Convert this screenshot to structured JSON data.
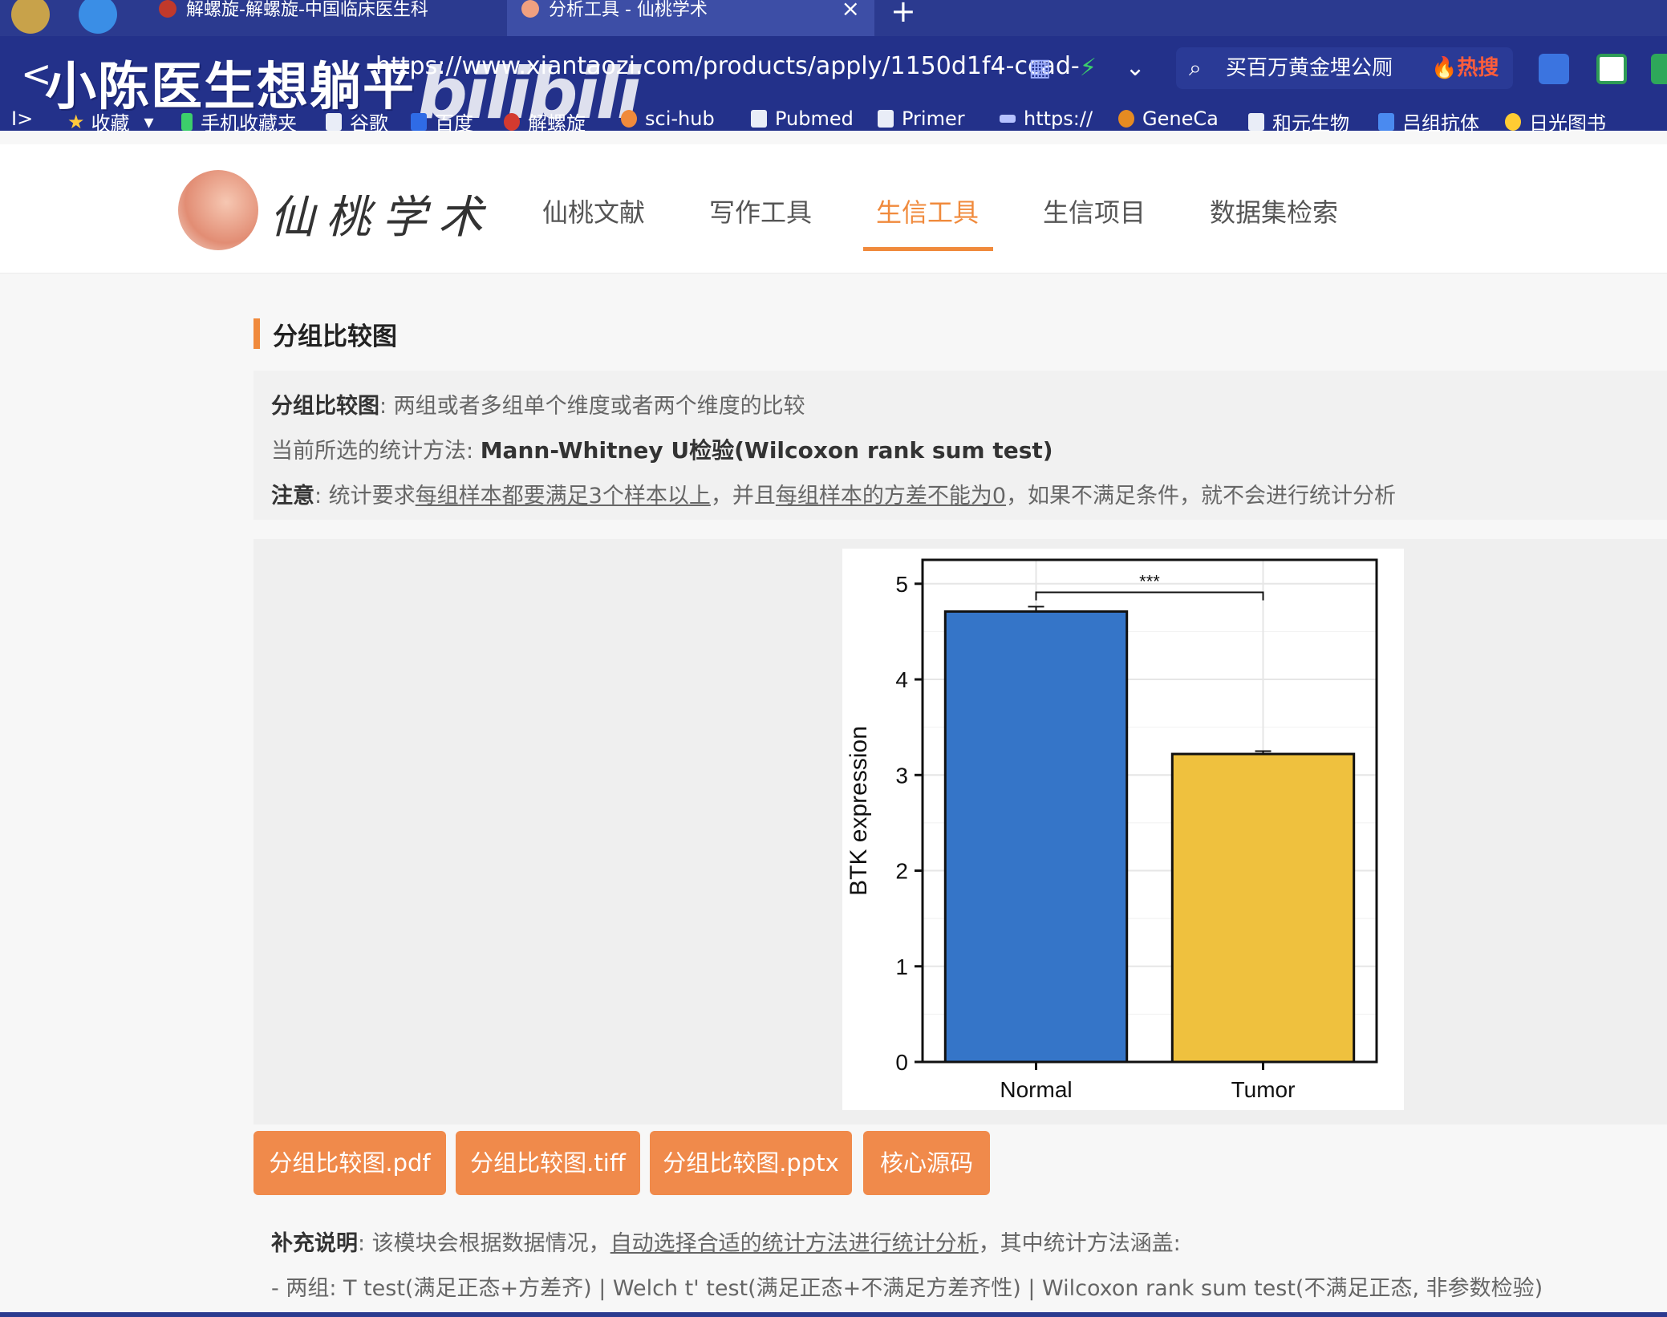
{
  "browser": {
    "tabs": [
      {
        "label": "解螺旋-解螺旋-中国临床医生科"
      },
      {
        "label": "分析工具 - 仙桃学术",
        "close": "×"
      }
    ],
    "new_tab": "+",
    "back": "<",
    "watermark": "小陈医生想躺平",
    "watermark_brand": "bilibili",
    "url": "https://www.xiantaozi.com/products/apply/1150d1f4-ccad-",
    "search_text": "买百万黄金埋公厕",
    "search_hot": "🔥热搜",
    "bookmarks": [
      {
        "label": "收藏"
      },
      {
        "label": "手机收藏夹"
      },
      {
        "label": "谷歌"
      },
      {
        "label": "百度"
      },
      {
        "label": "解螺旋"
      },
      {
        "label": "sci-hub"
      },
      {
        "label": "Pubmed"
      },
      {
        "label": "Primer"
      },
      {
        "label": "https://"
      },
      {
        "label": "GeneCa"
      },
      {
        "label": "和元生物"
      },
      {
        "label": "吕组抗体"
      },
      {
        "label": "日光图书"
      }
    ]
  },
  "site": {
    "logo_text": "仙桃学术",
    "nav": [
      "仙桃文献",
      "写作工具",
      "生信工具",
      "生信项目",
      "数据集检索"
    ],
    "active_nav": "生信工具"
  },
  "page": {
    "section_title": "分组比较图",
    "desc_label": "分组比较图",
    "desc_text": ": 两组或者多组单个维度或者两个维度的比较",
    "method_label": "当前所选的统计方法: ",
    "method_value": "Mann-Whitney U检验(Wilcoxon rank sum test)",
    "note_label": "注意",
    "note_pre": ": 统计要求",
    "note_u1": "每组样本都要满足3个样本以上",
    "note_mid": "，并且",
    "note_u2": "每组样本的方差不能为0",
    "note_post": "，如果不满足条件，就不会进行统计分析",
    "buttons": [
      "分组比较图.pdf",
      "分组比较图.tiff",
      "分组比较图.pptx",
      "核心源码"
    ],
    "supp_label": "补充说明",
    "supp_pre": ": 该模块会根据数据情况，",
    "supp_u": "自动选择合适的统计方法进行统计分析",
    "supp_post": "，其中统计方法涵盖:",
    "supp_line2": "- 两组: T test(满足正态+方差齐) | Welch t' test(满足正态+不满足方差齐性) | Wilcoxon rank sum test(不满足正态, 非参数检验)"
  },
  "chart_data": {
    "type": "bar",
    "categories": [
      "Normal",
      "Tumor"
    ],
    "values": [
      4.71,
      3.22
    ],
    "errors": [
      0.05,
      0.03
    ],
    "colors": [
      "#3575c8",
      "#efc13e"
    ],
    "ylabel": "BTK expression",
    "xlabel": "",
    "ylim": [
      0,
      5.25
    ],
    "yticks": [
      0,
      1,
      2,
      3,
      4,
      5
    ],
    "significance": "***",
    "grid": true
  }
}
